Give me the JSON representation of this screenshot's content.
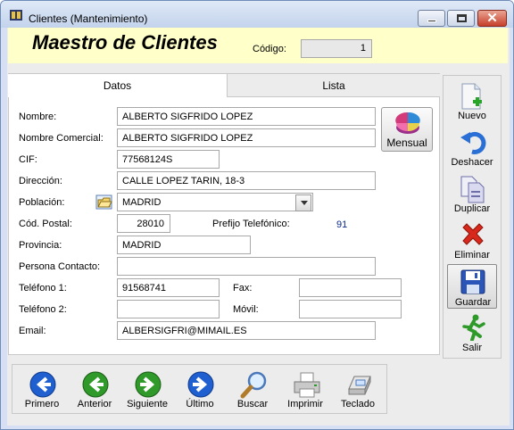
{
  "window": {
    "title": "Clientes  (Mantenimiento)",
    "close_glyph": "✕"
  },
  "header": {
    "form_title": "Maestro de Clientes",
    "code_label": "Código:",
    "code_value": "1"
  },
  "tabs": [
    {
      "label": "Datos",
      "active": true
    },
    {
      "label": "Lista",
      "active": false
    }
  ],
  "form": {
    "nombre": {
      "label": "Nombre:",
      "value": "ALBERTO SIGFRIDO LOPEZ"
    },
    "nombre_comercial": {
      "label": "Nombre Comercial:",
      "value": "ALBERTO SIGFRIDO LOPEZ"
    },
    "cif": {
      "label": "CIF:",
      "value": "77568124S"
    },
    "direccion": {
      "label": "Dirección:",
      "value": "CALLE LOPEZ TARIN, 18-3"
    },
    "poblacion": {
      "label": "Población:",
      "value": "MADRID"
    },
    "cod_postal": {
      "label": "Cód. Postal:",
      "value": "28010"
    },
    "prefijo": {
      "label": "Prefijo Telefónico:",
      "value": "91"
    },
    "provincia": {
      "label": "Provincia:",
      "value": "MADRID"
    },
    "persona_contacto": {
      "label": "Persona Contacto:",
      "value": ""
    },
    "telefono1": {
      "label": "Teléfono 1:",
      "value": "91568741"
    },
    "fax": {
      "label": "Fax:",
      "value": ""
    },
    "telefono2": {
      "label": "Teléfono 2:",
      "value": ""
    },
    "movil": {
      "label": "Móvil:",
      "value": ""
    },
    "email": {
      "label": "Email:",
      "value": "ALBERSIGFRI@MIMAIL.ES"
    },
    "mensual_label": "Mensual"
  },
  "sidebar": {
    "nuevo": "Nuevo",
    "deshacer": "Deshacer",
    "duplicar": "Duplicar",
    "eliminar": "Eliminar",
    "guardar": "Guardar",
    "salir": "Salir"
  },
  "bottom_nav": {
    "primero": "Primero",
    "anterior": "Anterior",
    "siguiente": "Siguiente",
    "ultimo": "Último",
    "buscar": "Buscar",
    "imprimir": "Imprimir",
    "teclado": "Teclado"
  },
  "colors": {
    "header_band": "#ffffc9",
    "nav_blue": "#1f5fd0",
    "nav_green": "#2f9a2a",
    "delete_red": "#d8281b"
  }
}
